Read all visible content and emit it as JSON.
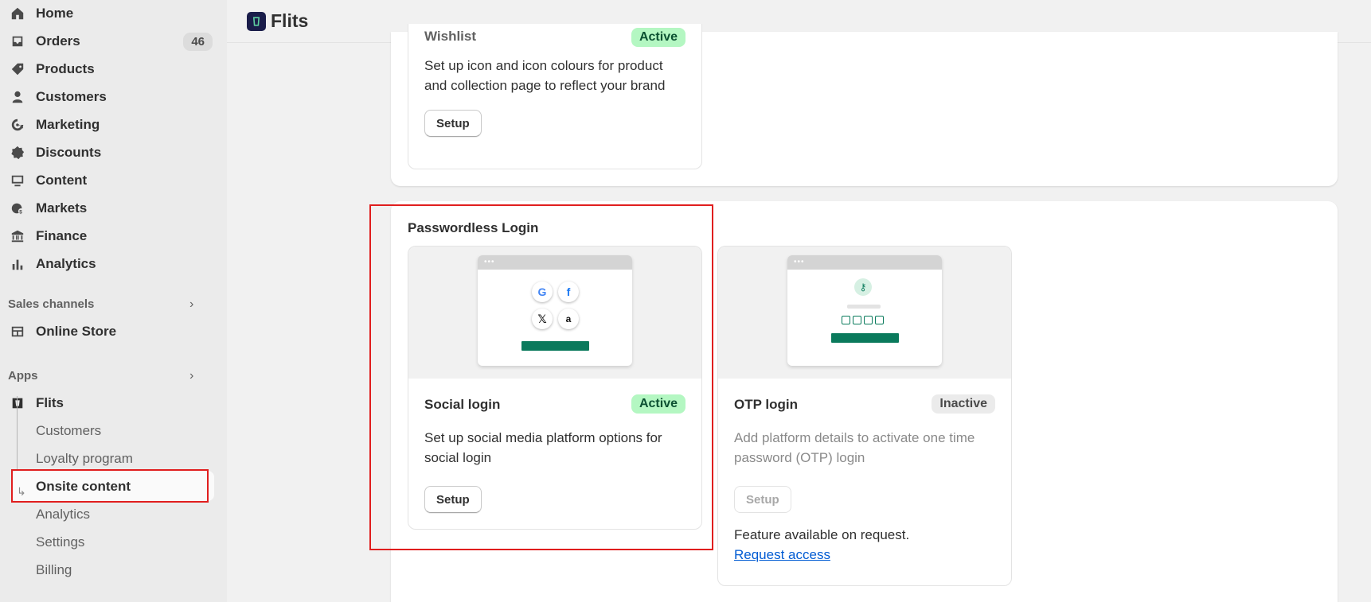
{
  "header": {
    "app_name": "Flits"
  },
  "sidebar": {
    "items": [
      {
        "label": "Home",
        "icon": "home-icon"
      },
      {
        "label": "Orders",
        "icon": "inbox-icon",
        "count": "46"
      },
      {
        "label": "Products",
        "icon": "tag-icon"
      },
      {
        "label": "Customers",
        "icon": "person-icon"
      },
      {
        "label": "Marketing",
        "icon": "target-icon"
      },
      {
        "label": "Discounts",
        "icon": "discount-icon"
      },
      {
        "label": "Content",
        "icon": "image-icon"
      },
      {
        "label": "Markets",
        "icon": "globe-icon"
      },
      {
        "label": "Finance",
        "icon": "bank-icon"
      },
      {
        "label": "Analytics",
        "icon": "bar-chart-icon"
      }
    ],
    "sales_channels_label": "Sales channels",
    "online_store_label": "Online Store",
    "apps_label": "Apps",
    "app_label": "Flits",
    "app_subitems": [
      "Customers",
      "Loyalty program",
      "Onsite content",
      "Analytics",
      "Settings",
      "Billing"
    ],
    "active_subitem": "Onsite content"
  },
  "wishlist_card": {
    "title": "Wishlist",
    "status": "Active",
    "description": "Set up icon and icon colours for product and collection page to reflect your brand",
    "button": "Setup"
  },
  "section": {
    "title": "Passwordless Login",
    "cards": [
      {
        "title": "Social login",
        "status": "Active",
        "description": "Set up social media platform options for social login",
        "button": "Setup"
      },
      {
        "title": "OTP login",
        "status": "Inactive",
        "description": "Add platform details to activate one time password (OTP) login",
        "button": "Setup",
        "note": "Feature available on request.",
        "link": "Request access"
      }
    ]
  },
  "colors": {
    "accent_green": "#0a7a5c",
    "active_badge": "#b4f7c2",
    "highlight_red": "#e01e1e",
    "link_blue": "#005bd3"
  }
}
